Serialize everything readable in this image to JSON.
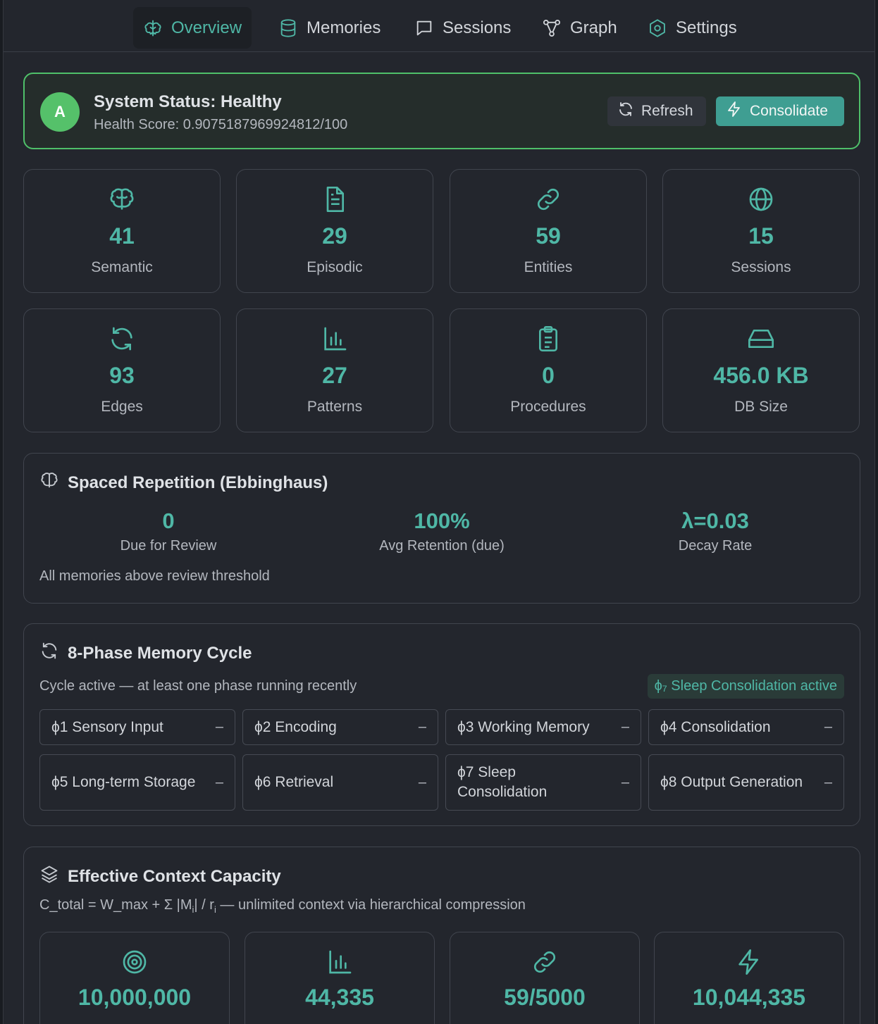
{
  "nav": {
    "tabs": [
      {
        "label": "Overview",
        "icon": "brain-tree-icon",
        "active": true
      },
      {
        "label": "Memories",
        "icon": "database-icon",
        "active": false
      },
      {
        "label": "Sessions",
        "icon": "chat-bubble-icon",
        "active": false
      },
      {
        "label": "Graph",
        "icon": "graph-nodes-icon",
        "active": false
      },
      {
        "label": "Settings",
        "icon": "gear-icon",
        "active": false
      }
    ]
  },
  "status": {
    "grade": "A",
    "title": "System Status: Healthy",
    "health": "Health Score: 0.9075187969924812/100",
    "refresh_label": "Refresh",
    "consolidate_label": "Consolidate"
  },
  "stats": [
    {
      "value": "41",
      "label": "Semantic",
      "icon": "brain-icon"
    },
    {
      "value": "29",
      "label": "Episodic",
      "icon": "document-icon"
    },
    {
      "value": "59",
      "label": "Entities",
      "icon": "link-icon"
    },
    {
      "value": "15",
      "label": "Sessions",
      "icon": "globe-icon"
    },
    {
      "value": "93",
      "label": "Edges",
      "icon": "refresh-icon"
    },
    {
      "value": "27",
      "label": "Patterns",
      "icon": "bar-chart-icon"
    },
    {
      "value": "0",
      "label": "Procedures",
      "icon": "clipboard-icon"
    },
    {
      "value": "456.0 KB",
      "label": "DB Size",
      "icon": "hard-drive-icon"
    }
  ],
  "spaced": {
    "title": "Spaced Repetition (Ebbinghaus)",
    "cols": [
      {
        "value": "0",
        "label": "Due for Review"
      },
      {
        "value": "100%",
        "label": "Avg Retention (due)"
      },
      {
        "value": "λ=0.03",
        "label": "Decay Rate"
      }
    ],
    "note": "All memories above review threshold"
  },
  "cycle": {
    "title": "8-Phase Memory Cycle",
    "subtitle": "Cycle active — at least one phase running recently",
    "badge": "ϕ₇ Sleep Consolidation active",
    "phases": [
      {
        "label": "ϕ1 Sensory Input",
        "dash": "–"
      },
      {
        "label": "ϕ2 Encoding",
        "dash": "–"
      },
      {
        "label": "ϕ3 Working Memory",
        "dash": "–"
      },
      {
        "label": "ϕ4 Consolidation",
        "dash": "–"
      },
      {
        "label": "ϕ5 Long-term Storage",
        "dash": "–"
      },
      {
        "label": "ϕ6 Retrieval",
        "dash": "–"
      },
      {
        "label": "ϕ7 Sleep Consolidation",
        "dash": "–"
      },
      {
        "label": "ϕ8 Output Generation",
        "dash": "–"
      }
    ]
  },
  "context": {
    "title": "Effective Context Capacity",
    "formula_a": "C_total = W_max + Σ |M",
    "formula_sub_i": "i",
    "formula_b": "| / r",
    "formula_sub_i2": "i",
    "formula_c": " — unlimited context via hierarchical compression",
    "cards": [
      {
        "value": "10,000,000",
        "icon": "target-icon"
      },
      {
        "value": "44,335",
        "icon": "bar-chart-icon"
      },
      {
        "value": "59/5000",
        "icon": "link-icon"
      },
      {
        "value": "10,044,335",
        "icon": "lightning-icon"
      }
    ]
  },
  "colors": {
    "accent": "#4fb7a6",
    "healthy": "#4fc06a",
    "background": "#23262d"
  }
}
